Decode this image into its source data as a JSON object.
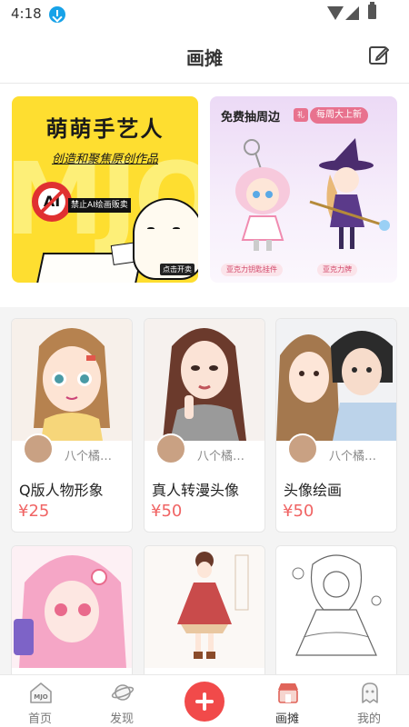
{
  "status": {
    "time": "4:18"
  },
  "header": {
    "title": "画摊"
  },
  "banners": {
    "left": {
      "title": "萌萌手艺人",
      "subtitle": "创造和聚焦原创作品",
      "tag": "禁止AI绘画贩卖",
      "bg_letters": "MJO",
      "corner": "点击开卖",
      "noai_text": "AI"
    },
    "right": {
      "title": "免费抽周边",
      "badge": "每周大上新",
      "mini": "礼",
      "chip1": "亚克力钥匙挂件",
      "chip2": "亚克力牌"
    }
  },
  "cards": [
    {
      "author": "八个橘…",
      "title": "Q版人物形象",
      "price": "¥25"
    },
    {
      "author": "八个橘…",
      "title": "真人转漫头像",
      "price": "¥50"
    },
    {
      "author": "八个橘…",
      "title": "头像绘画",
      "price": "¥50"
    },
    {
      "author": "",
      "title": "",
      "price": ""
    },
    {
      "author": "",
      "title": "",
      "price": ""
    },
    {
      "author": "",
      "title": "",
      "price": ""
    }
  ],
  "tabs": [
    {
      "label": "首页",
      "icon": "mjo-home-icon"
    },
    {
      "label": "发现",
      "icon": "planet-icon"
    },
    {
      "label": "",
      "icon": "plus-icon"
    },
    {
      "label": "画摊",
      "icon": "shop-icon"
    },
    {
      "label": "我的",
      "icon": "ghost-icon"
    }
  ],
  "colors": {
    "accent": "#f14a4a",
    "price": "#f06464",
    "banner_yellow": "#fede30",
    "badge_pink": "#e8728e"
  }
}
